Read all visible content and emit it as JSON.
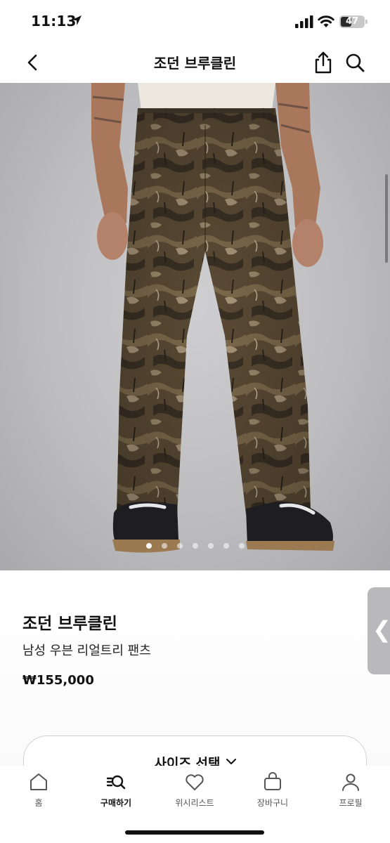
{
  "status_bar": {
    "time": "11:13",
    "battery": "47",
    "battery_fraction": 0.47
  },
  "header": {
    "title": "조던 브루클린"
  },
  "gallery": {
    "image_count": 7,
    "active_index": 0
  },
  "product": {
    "brand": "조던 브루클린",
    "name": "남성 우븐 리얼트리 팬츠",
    "price": "₩155,000"
  },
  "side_handle": {
    "glyph": "❮"
  },
  "size_select": {
    "label": "사이즈 선택"
  },
  "nav": {
    "items": [
      {
        "label": "홈",
        "icon": "home-icon"
      },
      {
        "label": "구매하기",
        "icon": "shop-search-icon"
      },
      {
        "label": "위시리스트",
        "icon": "heart-icon"
      },
      {
        "label": "장바구니",
        "icon": "bag-icon"
      },
      {
        "label": "프로필",
        "icon": "profile-icon"
      }
    ],
    "active": 1
  },
  "colors": {
    "accent": "#111111",
    "image_background": "#c4c4c7"
  }
}
